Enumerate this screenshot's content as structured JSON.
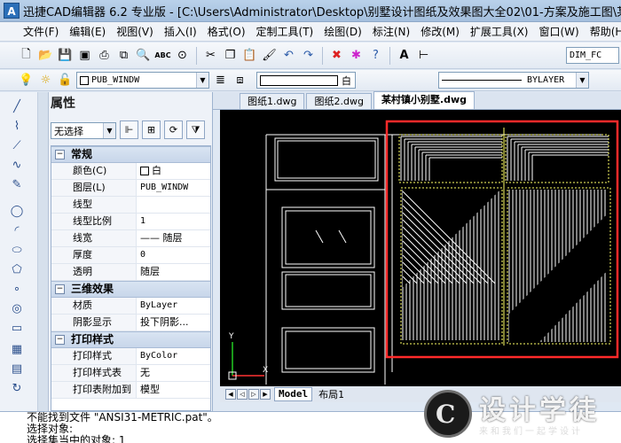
{
  "window": {
    "title": "迅捷CAD编辑器 6.2 专业版 - [C:\\Users\\Administrator\\Desktop\\别墅设计图纸及效果图大全02\\01-方案及施工图\\某村镇小",
    "logo_text": "A"
  },
  "menu": [
    "文件(F)",
    "编辑(E)",
    "视图(V)",
    "插入(I)",
    "格式(O)",
    "定制工具(T)",
    "绘图(D)",
    "标注(N)",
    "修改(M)",
    "扩展工具(X)",
    "窗口(W)",
    "帮助(H)"
  ],
  "toolbar": {
    "icons": [
      "new-icon",
      "open-icon",
      "save-icon",
      "saveas-icon",
      "print-icon",
      "print-preview-icon",
      "find-icon",
      "spellcheck-icon",
      "binoculars-icon",
      "cut-icon",
      "copy-icon",
      "paste-icon",
      "match-properties-icon",
      "undo-icon",
      "redo-icon",
      "erase-icon",
      "purge-icon",
      "help-icon",
      "text-style-icon",
      "dimension-style-icon"
    ],
    "dim_style": "DIM_FC"
  },
  "layer_toolbar": {
    "layer_value": "PUB_WINDW",
    "color_value": "白",
    "linetype_value": "BYLAYER"
  },
  "properties": {
    "title": "属性",
    "selection": "无选择",
    "categories": [
      {
        "name": "常规",
        "toggle": "−",
        "rows": [
          {
            "name": "颜色(C)",
            "value": "白",
            "swatch": true
          },
          {
            "name": "图层(L)",
            "value": "PUB_WINDW"
          },
          {
            "name": "线型",
            "value": ""
          },
          {
            "name": "线型比例",
            "value": "1"
          },
          {
            "name": "线宽",
            "value": "—— 随层"
          },
          {
            "name": "厚度",
            "value": "0"
          },
          {
            "name": "透明",
            "value": "随层"
          }
        ]
      },
      {
        "name": "三维效果",
        "toggle": "−",
        "rows": [
          {
            "name": "材质",
            "value": "ByLayer"
          },
          {
            "name": "阴影显示",
            "value": "投下阴影..."
          }
        ]
      },
      {
        "name": "打印样式",
        "toggle": "−",
        "rows": [
          {
            "name": "打印样式",
            "value": "ByColor"
          },
          {
            "name": "打印样式表",
            "value": "无"
          },
          {
            "name": "打印表附加到",
            "value": "模型"
          }
        ]
      }
    ]
  },
  "tabs": [
    "图纸1.dwg",
    "图纸2.dwg",
    "某村镇小别墅.dwg"
  ],
  "active_tab": 2,
  "layout_tabs": [
    "Model",
    "布局1"
  ],
  "ucs": {
    "x": "X",
    "y": "Y"
  },
  "command_lines": [
    "不能找到文件 \"ANSI31-METRIC.pat\"。",
    "选择对象:",
    "选择集当中的对象: 1"
  ],
  "watermark": {
    "logo": "C",
    "text": "设计学徒",
    "slogan": "来和我们一起学设计"
  },
  "colors": {
    "highlight_box": "#ff2a2a",
    "drawing_lines": "#ffffff",
    "hatch_boundary": "#ffff66",
    "canvas_bg": "#000000"
  }
}
